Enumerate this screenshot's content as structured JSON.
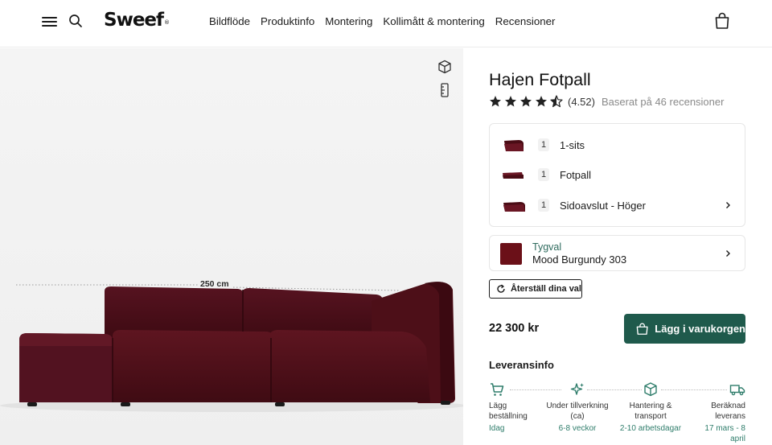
{
  "header": {
    "logo": "Sweef",
    "logo_mark": "®",
    "nav": [
      "Bildflöde",
      "Produktinfo",
      "Montering",
      "Kollimått & montering",
      "Recensioner"
    ]
  },
  "viewer": {
    "dimension_label": "250 cm",
    "icons": [
      "cube-3d-icon",
      "ruler-icon"
    ]
  },
  "product": {
    "title": "Hajen Fotpall",
    "rating_value": "(4.52)",
    "rating_text": "Baserat på 46 recensioner",
    "rating": 4.52,
    "parts": [
      {
        "qty": "1",
        "name": "1-sits"
      },
      {
        "qty": "1",
        "name": "Fotpall"
      },
      {
        "qty": "1",
        "name": "Sidoavslut - Höger"
      }
    ],
    "fabric_label": "Tygval",
    "fabric_value": "Mood Burgundy 303",
    "fabric_color": "#6b1018",
    "reset_label": "Återställ dina val",
    "price": "22 300 kr",
    "buy_label": "Lägg i varukorgen",
    "accent_color": "#1f5a4c"
  },
  "delivery": {
    "title": "Leveransinfo",
    "steps": [
      {
        "icon": "cart-icon",
        "title": "Lägg beställning",
        "sub": "Idag"
      },
      {
        "icon": "sparkle-icon",
        "title": "Under tillverkning (ca)",
        "sub": "6-8 veckor"
      },
      {
        "icon": "box-icon",
        "title": "Hantering & transport",
        "sub": "2-10 arbetsdagar"
      },
      {
        "icon": "truck-icon",
        "title": "Beräknad leverans",
        "sub": "17 mars - 8 april"
      }
    ]
  }
}
